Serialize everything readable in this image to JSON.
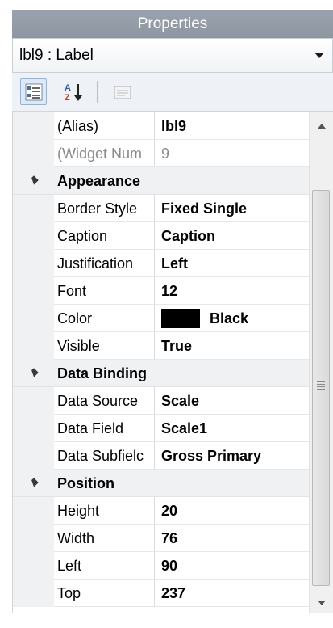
{
  "panel": {
    "title": "Properties"
  },
  "object_selector": {
    "value": "lbl9 : Label"
  },
  "toolbar": {
    "categorized_icon": "categorized-list-icon",
    "alphabetical_icon": "sort-az-icon",
    "property_pages_icon": "property-pages-icon"
  },
  "properties": {
    "alias": {
      "name": "(Alias)",
      "value": "lbl9"
    },
    "widget_num": {
      "name": "(Widget Num",
      "value": "9"
    },
    "appearance": {
      "label": "Appearance",
      "border_style": {
        "name": "Border Style",
        "value": "Fixed Single"
      },
      "caption": {
        "name": "Caption",
        "value": "Caption"
      },
      "justification": {
        "name": "Justification",
        "value": "Left"
      },
      "font": {
        "name": "Font",
        "value": "12"
      },
      "color": {
        "name": "Color",
        "value": "Black",
        "swatch": "#000000"
      },
      "visible": {
        "name": "Visible",
        "value": "True"
      }
    },
    "data_binding": {
      "label": "Data Binding",
      "data_source": {
        "name": "Data Source",
        "value": "Scale"
      },
      "data_field": {
        "name": "Data Field",
        "value": "Scale1"
      },
      "data_subfield": {
        "name": "Data Subfielc",
        "value": "Gross Primary"
      }
    },
    "position": {
      "label": "Position",
      "height": {
        "name": "Height",
        "value": "20"
      },
      "width": {
        "name": "Width",
        "value": "76"
      },
      "left": {
        "name": "Left",
        "value": "90"
      },
      "top": {
        "name": "Top",
        "value": "237"
      }
    }
  }
}
